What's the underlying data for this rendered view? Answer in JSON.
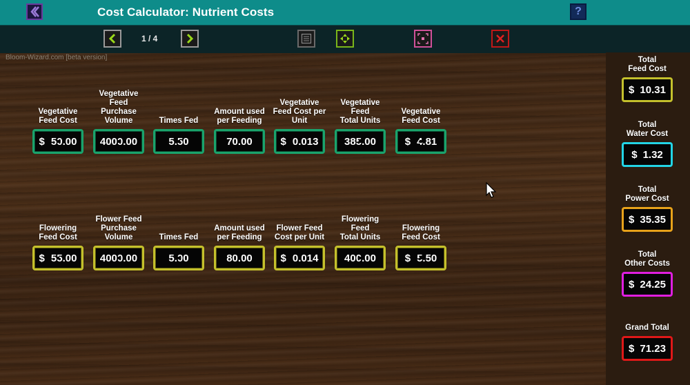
{
  "header": {
    "title": "Cost Calculator: Nutrient Costs",
    "back_icon": "chevron-left-icon",
    "help_label": "?"
  },
  "nav": {
    "page_indicator": "1 / 4",
    "toolbar_icons": [
      "prev-arrow-icon",
      "next-arrow-icon",
      "list-icon",
      "expand-icon",
      "compress-icon",
      "close-x-icon"
    ]
  },
  "watermark": "Bloom-Wizard.com [beta version]",
  "vegetative": {
    "labels": [
      "Vegetative\nFeed Cost",
      "Vegetative\nFeed\nPurchase\nVolume",
      "Times Fed",
      "Amount used\nper Feeding",
      "Vegetative\nFeed Cost per\nUnit",
      "Vegetative\nFeed\nTotal Units",
      "Vegetative\nFeed Cost"
    ],
    "values": [
      {
        "cur": "$",
        "val": "50.00"
      },
      {
        "cur": "",
        "val": "4000.00"
      },
      {
        "cur": "",
        "val": "5.50"
      },
      {
        "cur": "",
        "val": "70.00"
      },
      {
        "cur": "$",
        "val": "0.013"
      },
      {
        "cur": "",
        "val": "385.00"
      },
      {
        "cur": "$",
        "val": "4.81"
      }
    ]
  },
  "flowering": {
    "labels": [
      "Flowering\nFeed Cost",
      "Flower Feed\nPurchase\nVolume",
      "Times Fed",
      "Amount used\nper Feeding",
      "Flower Feed\nCost per Unit",
      "Flowering\nFeed\nTotal Units",
      "Flowering\nFeed Cost"
    ],
    "values": [
      {
        "cur": "$",
        "val": "55.00"
      },
      {
        "cur": "",
        "val": "4000.00"
      },
      {
        "cur": "",
        "val": "5.00"
      },
      {
        "cur": "",
        "val": "80.00"
      },
      {
        "cur": "$",
        "val": "0.014"
      },
      {
        "cur": "",
        "val": "400.00"
      },
      {
        "cur": "$",
        "val": "5.50"
      }
    ]
  },
  "totals": [
    {
      "label": "Total\nFeed Cost",
      "cur": "$",
      "val": "10.31",
      "color": "#c4c02c"
    },
    {
      "label": "Total\nWater Cost",
      "cur": "$",
      "val": "1.32",
      "color": "#22d4e6"
    },
    {
      "label": "Total\nPower Cost",
      "cur": "$",
      "val": "35.35",
      "color": "#e8a21a"
    },
    {
      "label": "Total\nOther Costs",
      "cur": "$",
      "val": "24.25",
      "color": "#e01ee0"
    },
    {
      "label": "Grand Total",
      "cur": "$",
      "val": "71.23",
      "color": "#e01818"
    }
  ],
  "colors": {
    "topbar": "#0e8c8a",
    "navbar": "#0c2427",
    "vegetative_border": "#1aa36c",
    "flowering_border": "#c4c02c"
  }
}
